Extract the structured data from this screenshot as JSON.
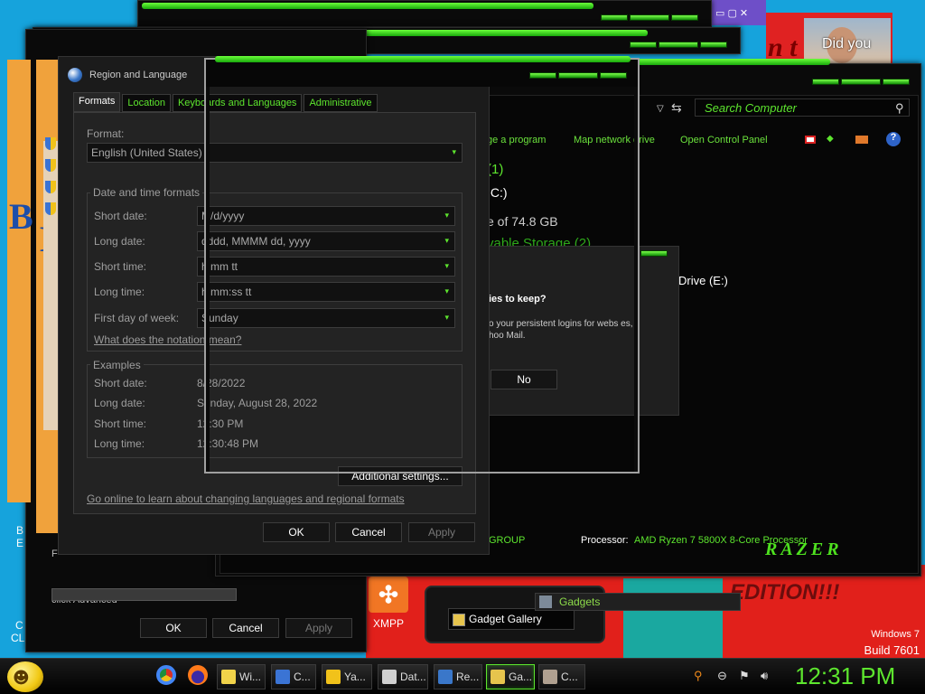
{
  "desktop": {
    "banner_text": "n t",
    "photo_caption": "Did you",
    "edition_text": "EDITION!!!",
    "win7_line1": "Windows 7",
    "win7_line2": "Build 7601",
    "icons": [
      {
        "label": "XMPP"
      }
    ],
    "left_icon_labels": [
      "B",
      "E",
      "C",
      "CLI"
    ]
  },
  "gadgets": {
    "gallery_label": "Gadget Gallery",
    "tag_label": "Gadgets"
  },
  "system_properties": {
    "line1": "F",
    "line2": "click Advanced",
    "ok": "OK",
    "cancel": "Cancel",
    "apply": "Apply"
  },
  "computer_window": {
    "search_placeholder": "Search Computer",
    "toolbar": [
      "ge a program",
      "Map network drive",
      "Open Control Panel"
    ],
    "section_hdd": "(1)",
    "drive_c": ":C:)",
    "free_space": "e of 74.8 GB",
    "section_removable": "vable Storage (2)",
    "drive_e": "Drive (E:)",
    "workgroup_value": "GROUP",
    "processor_label": "Processor:",
    "processor_value": "AMD Ryzen 7 5800X 8-Core Processor",
    "logo": "RAZER"
  },
  "cookie_dialog": {
    "title": "ies to keep?",
    "line1": "o your persistent logins for webs es,",
    "line2": "hoo Mail.",
    "no_button": "No"
  },
  "region_dialog": {
    "title": "Region and Language",
    "tabs": [
      "Formats",
      "Location",
      "Keyboards and Languages",
      "Administrative"
    ],
    "format_label": "Format:",
    "format_value": "English (United States)",
    "date_time_group": "Date and time formats",
    "rows": [
      {
        "label": "Short date:",
        "value": "M/d/yyyy"
      },
      {
        "label": "Long date:",
        "value": "dddd, MMMM dd, yyyy"
      },
      {
        "label": "Short time:",
        "value": "h:mm tt"
      },
      {
        "label": "Long time:",
        "value": "h:mm:ss tt"
      },
      {
        "label": "First day of week:",
        "value": "Sunday"
      }
    ],
    "notation_link": "What does the notation mean?",
    "examples_group": "Examples",
    "examples": [
      {
        "label": "Short date:",
        "value": "8/28/2022"
      },
      {
        "label": "Long date:",
        "value": "Sunday, August 28, 2022"
      },
      {
        "label": "Short time:",
        "value": "12:30 PM"
      },
      {
        "label": "Long time:",
        "value": "12:30:48 PM"
      }
    ],
    "additional_settings": "Additional settings...",
    "online_link": "Go online to learn about changing languages and regional formats",
    "ok": "OK",
    "cancel": "Cancel",
    "apply": "Apply"
  },
  "taskbar": {
    "buttons": [
      {
        "label": "Wi...",
        "icon": "folder-icon",
        "color": "#f1d34a"
      },
      {
        "label": "C...",
        "icon": "document-icon",
        "color": "#3b74d4"
      },
      {
        "label": "Ya...",
        "icon": "smiley-icon",
        "color": "#f1c21a"
      },
      {
        "label": "Dat...",
        "icon": "clock-doc-icon",
        "color": "#d0d0d0"
      },
      {
        "label": "Re...",
        "icon": "globe-icon",
        "color": "#3a77c9"
      },
      {
        "label": "Ga...",
        "icon": "gadget-icon",
        "color": "#e6c44d"
      },
      {
        "label": "C...",
        "icon": "computer-icon",
        "color": "#b0a090"
      }
    ],
    "clock": "12:31 PM",
    "accent": "#5de52e"
  }
}
